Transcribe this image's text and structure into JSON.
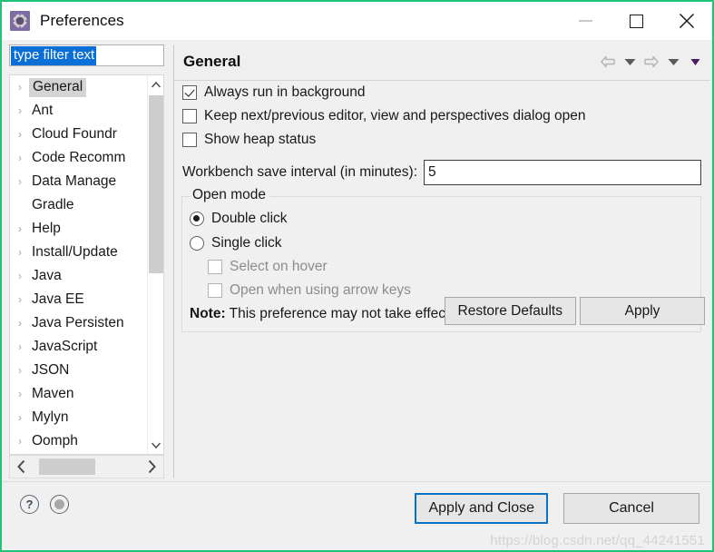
{
  "window": {
    "title": "Preferences",
    "icon": "preferences-gear-icon",
    "controls": {
      "minimize": "minimize-icon",
      "maximize": "maximize-icon",
      "close": "close-icon"
    }
  },
  "sidebar": {
    "filter": {
      "value": "type filter text",
      "placeholder": "type filter text",
      "selected": true
    },
    "items": [
      {
        "label": "General",
        "expandable": true,
        "selected": true
      },
      {
        "label": "Ant",
        "expandable": true,
        "selected": false
      },
      {
        "label": "Cloud Foundr",
        "expandable": true,
        "selected": false
      },
      {
        "label": "Code Recomm",
        "expandable": true,
        "selected": false
      },
      {
        "label": "Data Manage",
        "expandable": true,
        "selected": false
      },
      {
        "label": "Gradle",
        "expandable": false,
        "selected": false
      },
      {
        "label": "Help",
        "expandable": true,
        "selected": false
      },
      {
        "label": "Install/Update",
        "expandable": true,
        "selected": false
      },
      {
        "label": "Java",
        "expandable": true,
        "selected": false
      },
      {
        "label": "Java EE",
        "expandable": true,
        "selected": false
      },
      {
        "label": "Java Persisten",
        "expandable": true,
        "selected": false
      },
      {
        "label": "JavaScript",
        "expandable": true,
        "selected": false
      },
      {
        "label": "JSON",
        "expandable": true,
        "selected": false
      },
      {
        "label": "Maven",
        "expandable": true,
        "selected": false
      },
      {
        "label": "Mylyn",
        "expandable": true,
        "selected": false
      },
      {
        "label": "Oomph",
        "expandable": true,
        "selected": false
      }
    ],
    "scroll": {
      "up_arrow": "chevron-up-icon",
      "down_arrow": "chevron-down-icon",
      "left_arrow": "chevron-left-icon",
      "right_arrow": "chevron-right-icon"
    }
  },
  "content": {
    "title": "General",
    "nav": {
      "back": "back-arrow-icon",
      "back_menu": "chevron-down-icon",
      "forward": "forward-arrow-icon",
      "forward_menu": "chevron-down-icon",
      "view_menu": "chevron-down-icon"
    },
    "checkboxes": [
      {
        "label": "Always run in background",
        "checked": true,
        "enabled": true
      },
      {
        "label": "Keep next/previous editor, view and perspectives dialog open",
        "checked": false,
        "enabled": true
      },
      {
        "label": "Show heap status",
        "checked": false,
        "enabled": true
      }
    ],
    "interval": {
      "label": "Workbench save interval (in minutes):",
      "value": "5"
    },
    "open_mode": {
      "title": "Open mode",
      "radios": [
        {
          "label": "Double click",
          "selected": true
        },
        {
          "label": "Single click",
          "selected": false
        }
      ],
      "sub_checkboxes": [
        {
          "label": "Select on hover",
          "checked": false,
          "enabled": false
        },
        {
          "label": "Open when using arrow keys",
          "checked": false,
          "enabled": false
        }
      ],
      "note_prefix": "Note:",
      "note_text": " This preference may not take effect on all views"
    },
    "buttons": {
      "restore_defaults": "Restore Defaults",
      "apply": "Apply"
    }
  },
  "footer": {
    "help_icon": "help-question-icon",
    "info_icon": "record-circle-icon",
    "apply_and_close": "Apply and Close",
    "cancel": "Cancel"
  },
  "watermark": "https://blog.csdn.net/qq_44241551",
  "colors": {
    "accent": "#0a72c4",
    "selection": "#0a6fd6",
    "dialog_bg": "#f0f0f0",
    "frame": "#22c27b"
  }
}
